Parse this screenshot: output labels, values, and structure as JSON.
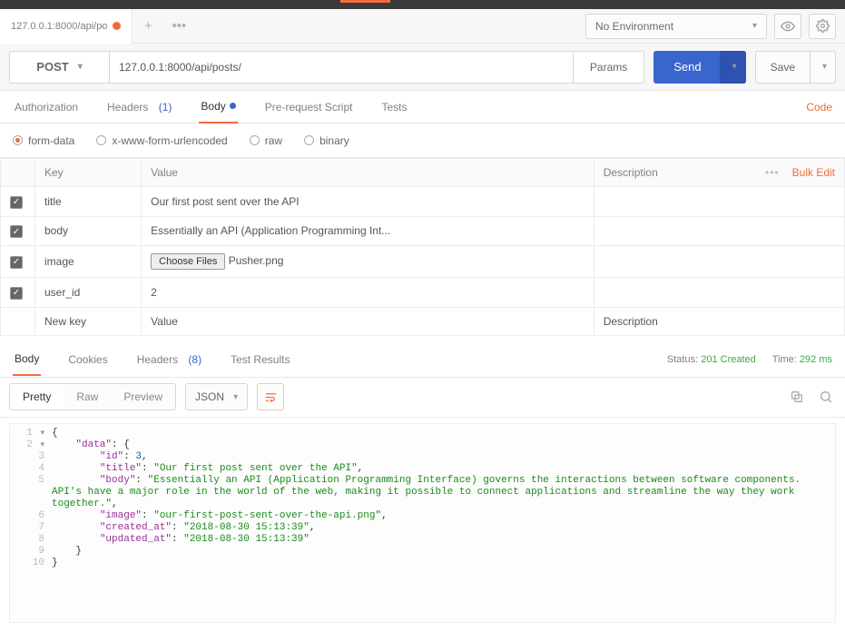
{
  "tab": {
    "title": "127.0.0.1:8000/api/po"
  },
  "env": {
    "label": "No Environment"
  },
  "request": {
    "method": "POST",
    "url": "127.0.0.1:8000/api/posts/",
    "paramsLabel": "Params",
    "sendLabel": "Send",
    "saveLabel": "Save"
  },
  "reqtabs": {
    "authorization": "Authorization",
    "headers": "Headers",
    "headersCount": "(1)",
    "body": "Body",
    "prerequest": "Pre-request Script",
    "tests": "Tests",
    "code": "Code"
  },
  "bodyTypes": {
    "formdata": "form-data",
    "urlencoded": "x-www-form-urlencoded",
    "raw": "raw",
    "binary": "binary"
  },
  "formTable": {
    "hKey": "Key",
    "hValue": "Value",
    "hDesc": "Description",
    "bulk": "Bulk Edit",
    "rows": [
      {
        "key": "title",
        "value": "Our first post sent over the API"
      },
      {
        "key": "body",
        "value": "Essentially an API (Application Programming Int..."
      },
      {
        "key": "image",
        "file": "Pusher.png"
      },
      {
        "key": "user_id",
        "value": "2"
      }
    ],
    "chooseFiles": "Choose Files",
    "phKey": "New key",
    "phValue": "Value",
    "phDesc": "Description"
  },
  "resp": {
    "tabs": {
      "body": "Body",
      "cookies": "Cookies",
      "headers": "Headers",
      "headersCount": "(8)",
      "tests": "Test Results"
    },
    "statusLabel": "Status:",
    "statusValue": "201 Created",
    "timeLabel": "Time:",
    "timeValue": "292 ms",
    "fmt": {
      "pretty": "Pretty",
      "raw": "Raw",
      "preview": "Preview",
      "json": "JSON"
    }
  },
  "json": {
    "l1": "{",
    "l2k": "\"data\"",
    "l2v": ": {",
    "l3k": "\"id\"",
    "l3v": ": ",
    "l3n": "3",
    "l3t": ",",
    "l4k": "\"title\"",
    "l4v": ": ",
    "l4s": "\"Our first post sent over the API\"",
    "l4t": ",",
    "l5k": "\"body\"",
    "l5v": ": ",
    "l5s": "\"Essentially an API (Application Programming Interface) governs the interactions between software components. API's have a major role in the world of the web, making it possible to connect applications and streamline the way they work together.\"",
    "l5t": ",",
    "l6k": "\"image\"",
    "l6v": ": ",
    "l6s": "\"our-first-post-sent-over-the-api.png\"",
    "l6t": ",",
    "l7k": "\"created_at\"",
    "l7v": ": ",
    "l7s": "\"2018-08-30 15:13:39\"",
    "l7t": ",",
    "l8k": "\"updated_at\"",
    "l8v": ": ",
    "l8s": "\"2018-08-30 15:13:39\"",
    "l9": "    }",
    "l10": "}"
  }
}
